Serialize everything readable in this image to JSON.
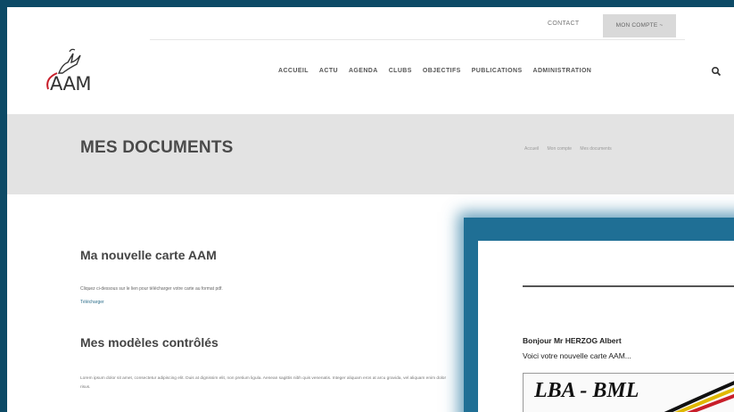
{
  "topbar": {
    "contact": "CONTACT",
    "account": "MON COMPTE ~"
  },
  "header": {
    "logo_text": "AAM",
    "nav": [
      "ACCUEIL",
      "ACTU",
      "AGENDA",
      "CLUBS",
      "OBJECTIFS",
      "PUBLICATIONS",
      "ADMINISTRATION"
    ]
  },
  "title_band": {
    "title": "MES DOCUMENTS",
    "breadcrumb": [
      "Accueil",
      "Mon compte",
      "Mes documents"
    ]
  },
  "main": {
    "card_heading": "Ma nouvelle carte AAM",
    "card_text": "Cliquez ci-dessous sur le lien pour télécharger votre carte au format pdf.",
    "card_link": "Télécharger",
    "models_heading": "Mes modèles contrôlés",
    "models_text": "Lorem ipsum dolor sit amet, consectetur adipiscing elit. Duis at dignissim elit, non pretium ligula. Aenean sagittis nibh quis venenatis. Integer aliquam eros at arcu gravida, vel aliquam enim dolor risus."
  },
  "overlay": {
    "greeting": "Bonjour Mr HERZOG Albert",
    "new_card": "Voici votre nouvelle carte AAM...",
    "card_logo": "LBA - BML"
  },
  "colors": {
    "frame_bg": "#0d4a66",
    "title_band": "#e3e3e3",
    "overlay_glow": "#1f6f95"
  }
}
